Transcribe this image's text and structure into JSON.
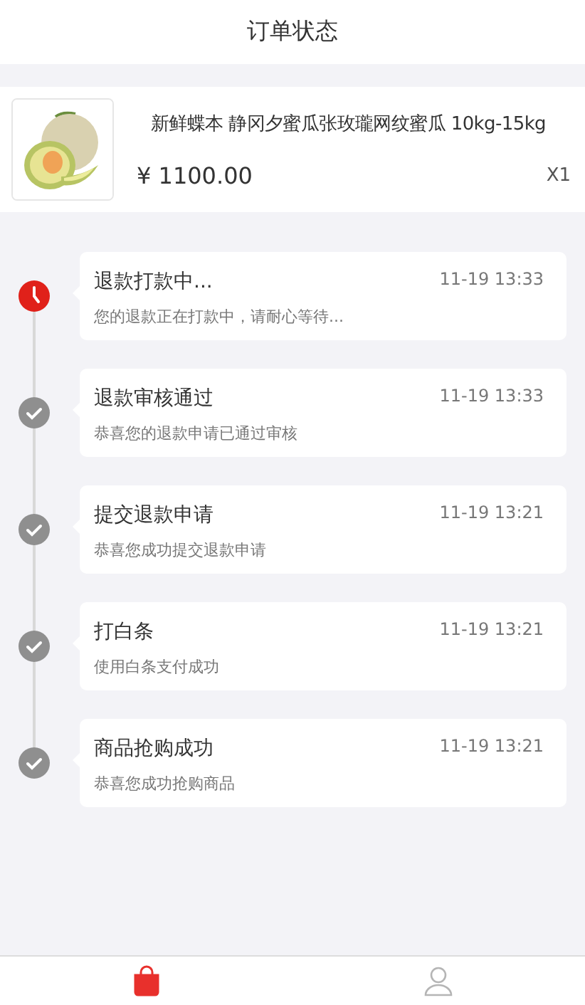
{
  "header": {
    "title": "订单状态"
  },
  "product": {
    "name": "新鲜蝶本 静冈夕蜜瓜张玫瓏网纹蜜瓜 10kg-15kg",
    "price": "¥ 1100.00",
    "quantity": "X1"
  },
  "steps": [
    {
      "kind": "current",
      "title": "退款打款中...",
      "time": "11-19 13:33",
      "detail": "您的退款正在打款中，请耐心等待..."
    },
    {
      "kind": "done",
      "title": "退款审核通过",
      "time": "11-19 13:33",
      "detail": "恭喜您的退款申请已通过审核"
    },
    {
      "kind": "done",
      "title": "提交退款申请",
      "time": "11-19 13:21",
      "detail": "恭喜您成功提交退款申请"
    },
    {
      "kind": "done",
      "title": "打白条",
      "time": "11-19 13:21",
      "detail": "使用白条支付成功"
    },
    {
      "kind": "done",
      "title": "商品抢购成功",
      "time": "11-19 13:21",
      "detail": "恭喜您成功抢购商品"
    }
  ],
  "tab_bar": [
    {
      "kind": "bag",
      "selected": true
    },
    {
      "kind": "person",
      "selected": false
    }
  ]
}
